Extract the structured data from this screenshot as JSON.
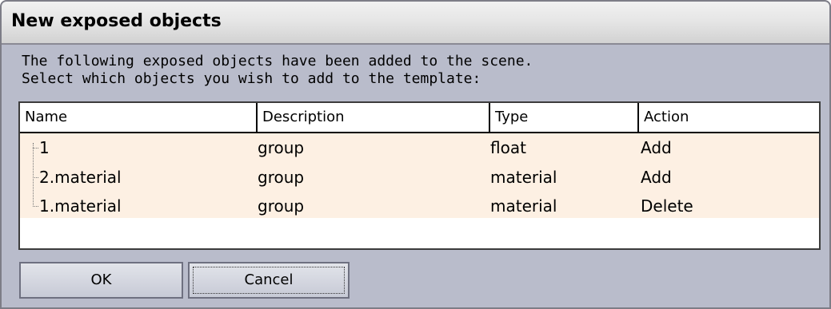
{
  "dialog": {
    "title": "New exposed objects",
    "message_line1": "The following exposed objects have been added to the scene.",
    "message_line2": "Select which objects you wish to add to the template:"
  },
  "table": {
    "columns": [
      "Name",
      "Description",
      "Type",
      "Action"
    ],
    "rows": [
      {
        "name": "1",
        "description": "group",
        "type": "float",
        "action": "Add"
      },
      {
        "name": "2.material",
        "description": "group",
        "type": "material",
        "action": "Add"
      },
      {
        "name": "1.material",
        "description": "group",
        "type": "material",
        "action": "Delete"
      }
    ]
  },
  "buttons": {
    "ok": "OK",
    "cancel": "Cancel"
  }
}
